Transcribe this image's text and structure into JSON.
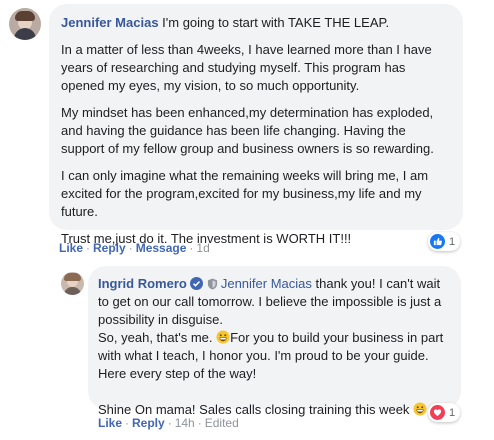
{
  "comment": {
    "author": "Jennifer Macias",
    "first_line": " I'm going to start with TAKE THE LEAP.",
    "paragraphs": [
      "In a matter of less than 4weeks, I have learned more than I have years of researching and studying myself. This program has opened my eyes, my vision, to so much opportunity.",
      "My mindset has been enhanced,my determination has exploded, and having the guidance has been life changing. Having the support of my fellow group and business owners is so rewarding.",
      "I can only imagine what the remaining weeks will bring me, I am excited for the program,excited for my business,my life and my future.",
      "Trust me,just do it. The investment is WORTH IT!!!"
    ],
    "actions": {
      "like": "Like",
      "reply": "Reply",
      "message": "Message",
      "time": "1d"
    },
    "reaction": {
      "icon": "like-icon",
      "count": "1",
      "color": "#1877f2"
    }
  },
  "reply": {
    "author": "Ingrid Romero",
    "mention": "Jennifer Macias",
    "line1": " thank you! I can't wait to get on our call tomorrow. I believe the impossible is just a possibility in disguise.",
    "line2_a": "So, yeah, that's me. ",
    "line2_b": "For you to build your business in part with what I teach, I honor you. I'm proud to be your guide. Here every step of the way!",
    "line3": "Shine On mama! Sales calls closing training this week ",
    "actions": {
      "like": "Like",
      "reply": "Reply",
      "time": "14h",
      "edited": "Edited"
    },
    "reaction": {
      "icon": "love-icon",
      "count": "1",
      "color": "#f33e58"
    }
  },
  "colors": {
    "link": "#385898",
    "action_link": "#4267b2",
    "bubble": "#f2f3f5",
    "meta": "#90949c"
  }
}
